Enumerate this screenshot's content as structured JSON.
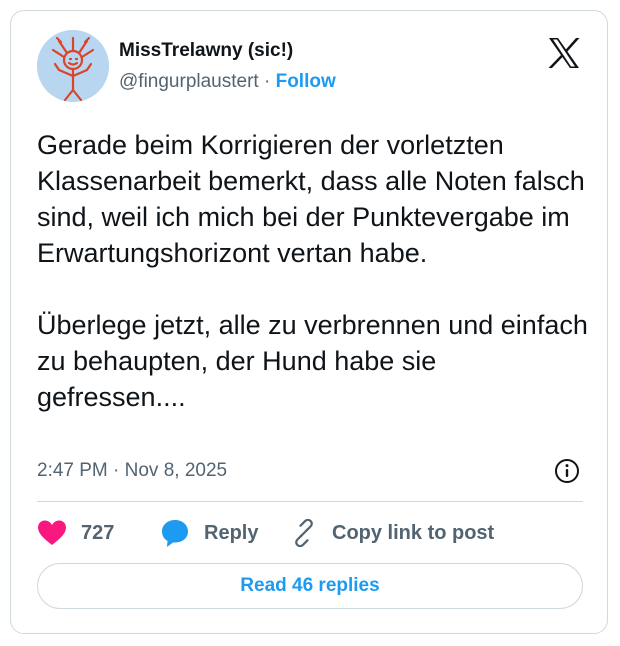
{
  "author": {
    "display_name": "MissTrelawny (sic!)",
    "handle": "@fingurplaustert",
    "separator": " · ",
    "follow_label": "Follow",
    "avatar_icon": "stick-figure-drawing-avatar"
  },
  "brand": {
    "logo_icon": "x-logo-icon"
  },
  "tweet": {
    "text": "Gerade beim Korrigieren der vorletzten Klassenarbeit bemerkt, dass alle Noten falsch sind, weil ich mich bei der Punktevergabe im Erwartungshorizont vertan habe.\n\nÜberlege jetzt, alle zu verbrennen und einfach zu behaupten, der Hund habe sie gefressen....",
    "timestamp": "2:47 PM · Nov 8, 2025"
  },
  "actions": {
    "like_count": "727",
    "reply_label": "Reply",
    "copy_link_label": "Copy link to post"
  },
  "footer": {
    "read_replies_label": "Read 46 replies"
  },
  "colors": {
    "accent": "#1d9bf0",
    "like": "#f91880",
    "text": "#0f1419",
    "secondary": "#536471",
    "border": "#cfd9de"
  }
}
